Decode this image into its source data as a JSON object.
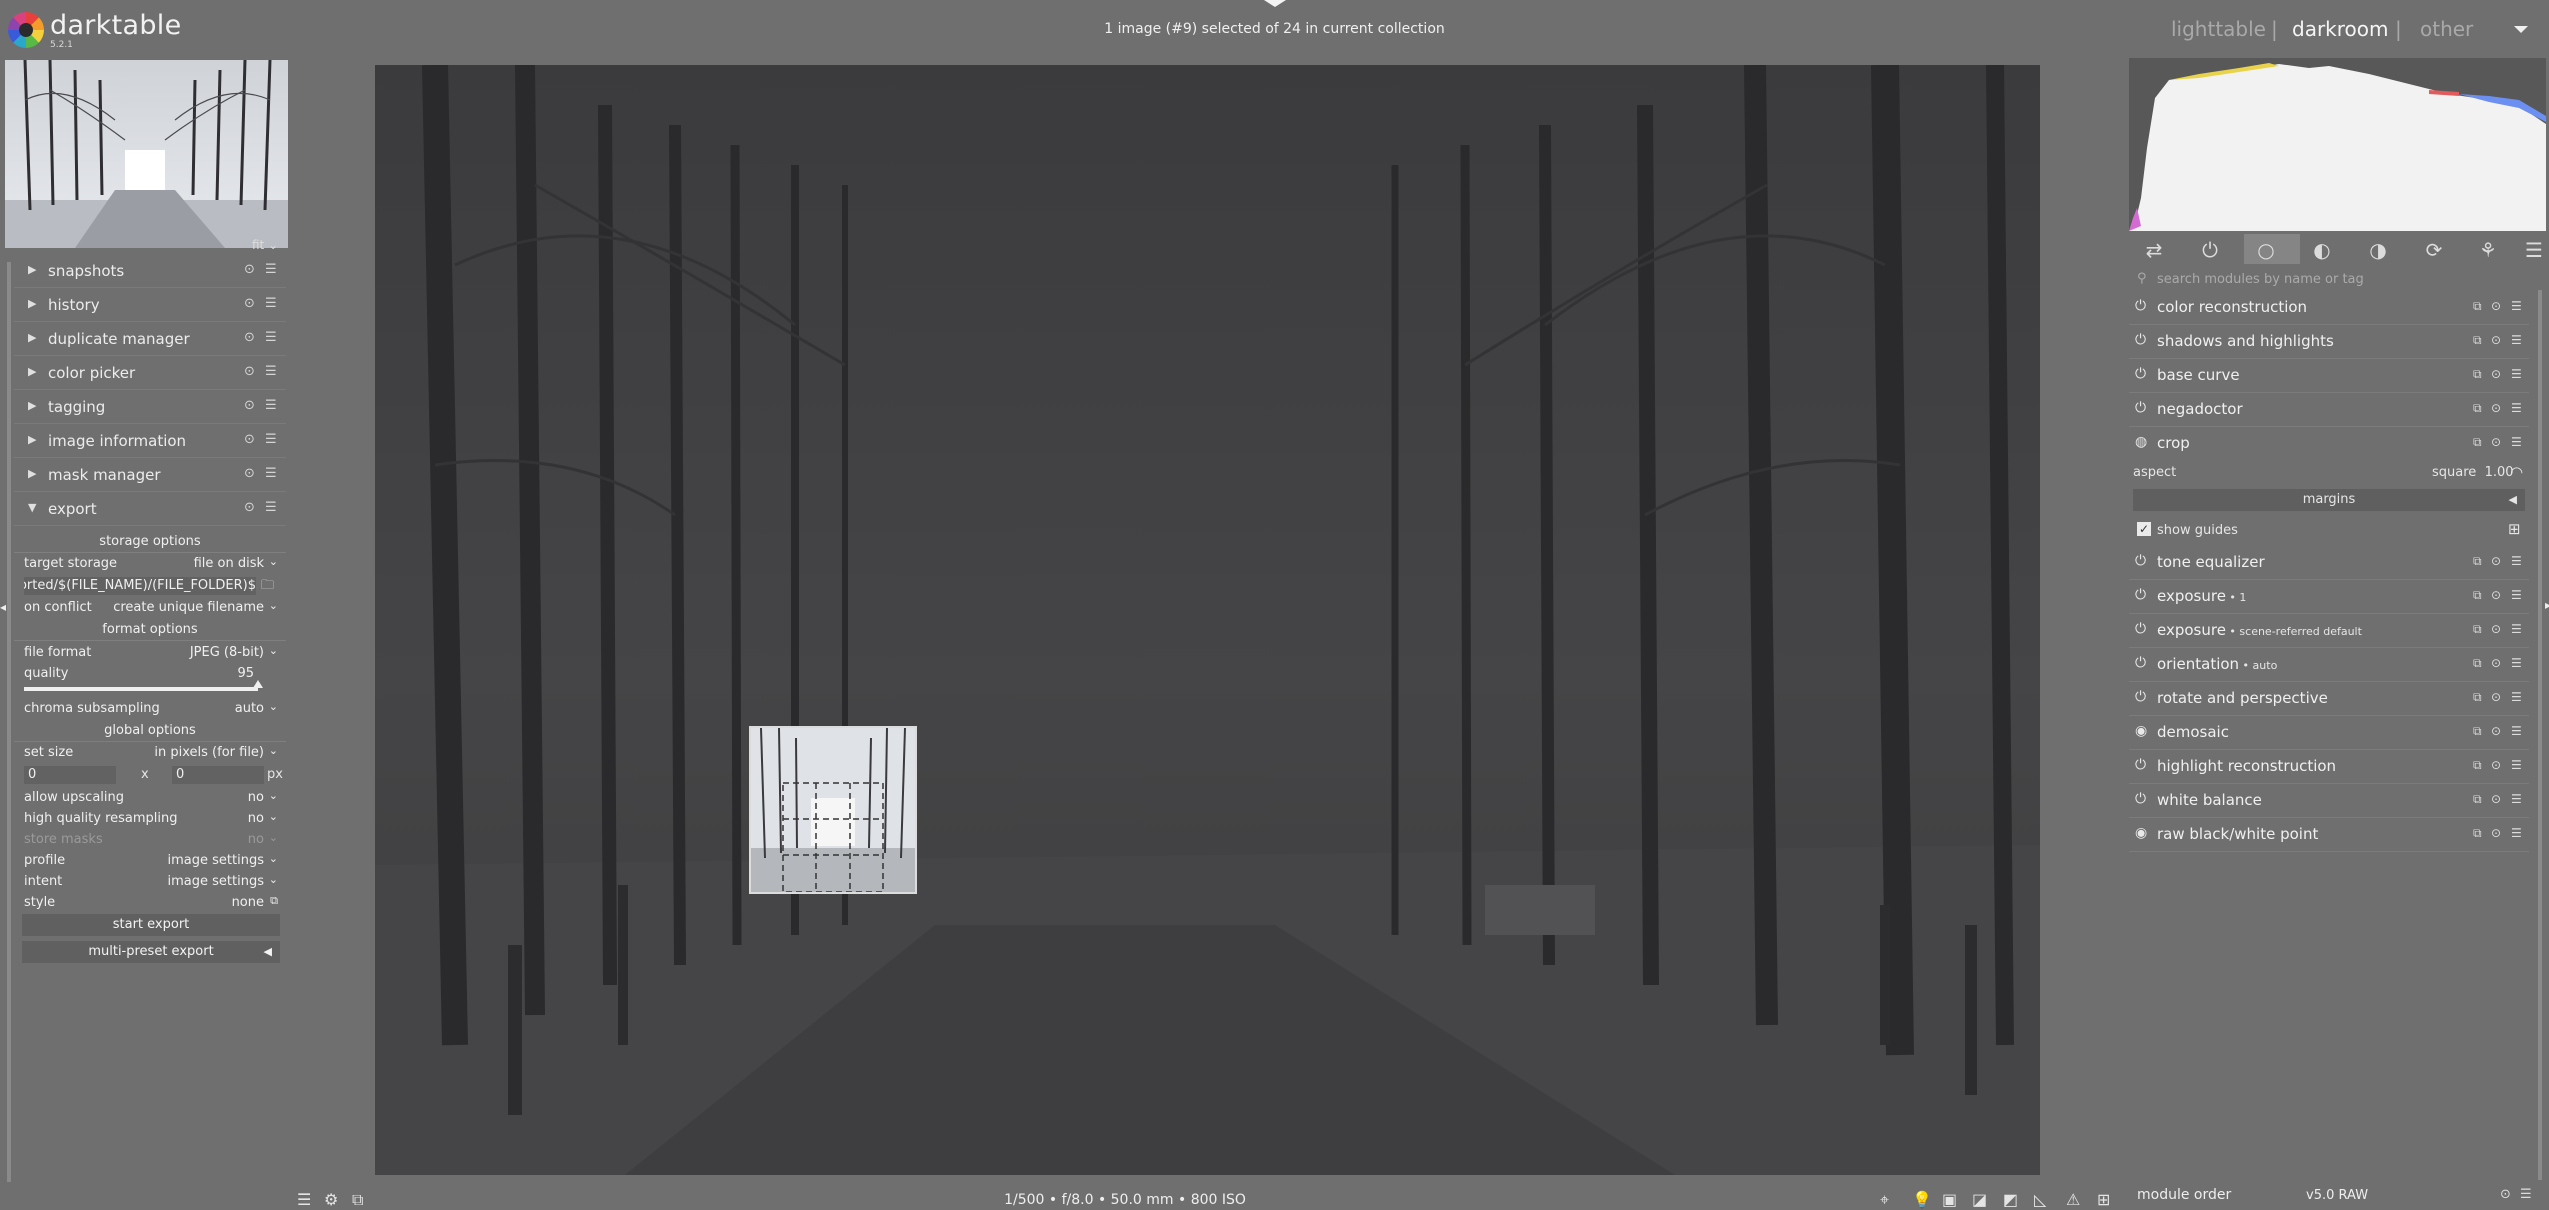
{
  "app": {
    "name": "darktable",
    "version": "5.2.1"
  },
  "header": {
    "collection_info": "1 image (#9) selected of 24 in current collection",
    "views": [
      "lighttable",
      "darkroom",
      "other"
    ],
    "separator": "|"
  },
  "left": {
    "fit_label": "fit",
    "modules": [
      {
        "label": "snapshots"
      },
      {
        "label": "history"
      },
      {
        "label": "duplicate manager"
      },
      {
        "label": "color picker"
      },
      {
        "label": "tagging"
      },
      {
        "label": "image information"
      },
      {
        "label": "mask manager"
      },
      {
        "label": "export"
      }
    ],
    "export": {
      "storage_options": "storage options",
      "target_storage_label": "target storage",
      "target_storage_value": "file on disk",
      "path_value": "$(FILE_FOLDER)/darktable_exported/$(FILE_NAME)",
      "on_conflict_label": "on conflict",
      "on_conflict_value": "create unique filename",
      "format_options": "format options",
      "file_format_label": "file format",
      "file_format_value": "JPEG (8-bit)",
      "quality_label": "quality",
      "quality_value": "95",
      "quality_fraction": 0.95,
      "chroma_label": "chroma subsampling",
      "chroma_value": "auto",
      "global_options": "global options",
      "set_size_label": "set size",
      "set_size_value": "in pixels (for file)",
      "width_value": "0",
      "x_label": "x",
      "height_value": "0",
      "px_label": "px",
      "upscaling_label": "allow upscaling",
      "upscaling_value": "no",
      "hq_label": "high quality resampling",
      "hq_value": "no",
      "masks_label": "store masks",
      "masks_value": "no",
      "profile_label": "profile",
      "profile_value": "image settings",
      "intent_label": "intent",
      "intent_value": "image settings",
      "style_label": "style",
      "style_value": "none",
      "start_export": "start export",
      "multi_preset": "multi-preset export"
    }
  },
  "center": {
    "image_info": "1/500 • f/8.0 • 50.0 mm • 800 ISO"
  },
  "right": {
    "search_placeholder": "search modules by name or tag",
    "modules_top": [
      {
        "label": "color reconstruction",
        "sub": ""
      },
      {
        "label": "shadows and highlights",
        "sub": ""
      },
      {
        "label": "base curve",
        "sub": ""
      },
      {
        "label": "negadoctor",
        "sub": ""
      },
      {
        "label": "crop",
        "sub": ""
      }
    ],
    "crop": {
      "aspect_label": "aspect",
      "aspect_value": "square",
      "aspect_ratio": "1.00",
      "margins_label": "margins",
      "show_guides_label": "show guides"
    },
    "modules_bottom": [
      {
        "label": "tone equalizer",
        "sub": ""
      },
      {
        "label": "exposure",
        "sub": " • 1"
      },
      {
        "label": "exposure",
        "sub": " • scene-referred default"
      },
      {
        "label": "orientation",
        "sub": " • auto"
      },
      {
        "label": "rotate and perspective",
        "sub": ""
      },
      {
        "label": "demosaic",
        "sub": ""
      },
      {
        "label": "highlight reconstruction",
        "sub": ""
      },
      {
        "label": "white balance",
        "sub": ""
      },
      {
        "label": "raw black/white point",
        "sub": ""
      }
    ],
    "module_order_label": "module order",
    "module_order_value": "v5.0 RAW"
  },
  "icons": {
    "reset": "reset-icon",
    "presets": "presets-icon",
    "power": "power-icon",
    "multi_instance": "multi-instance-icon"
  }
}
